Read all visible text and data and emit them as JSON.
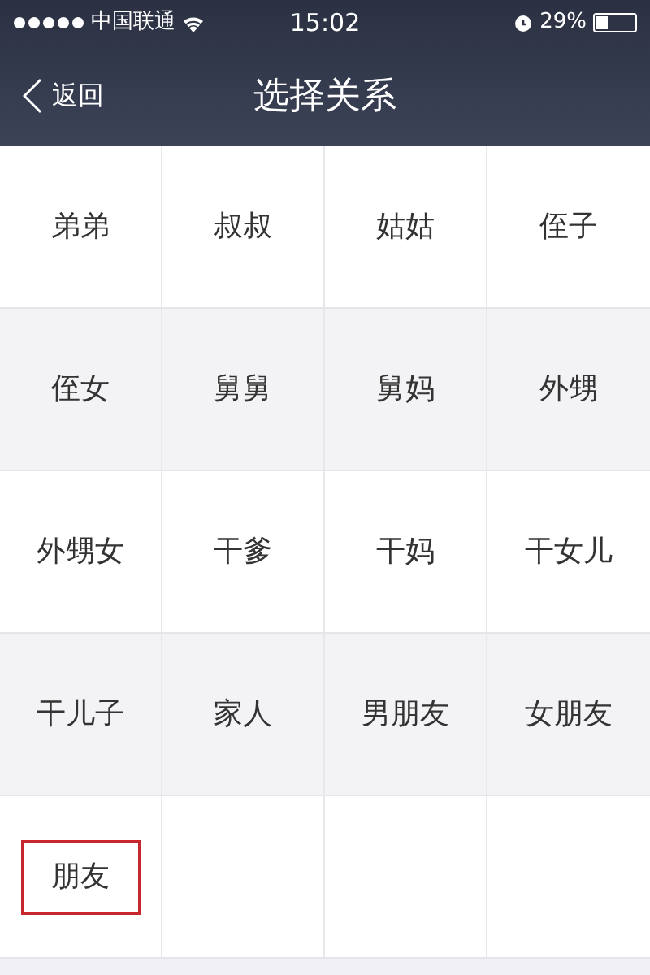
{
  "status_bar": {
    "carrier": "中国联通",
    "time": "15:02",
    "battery_percent": "29%",
    "battery": {
      "level": 0.29
    }
  },
  "nav": {
    "back": "返回",
    "title": "选择关系"
  },
  "relations": [
    {
      "label": "弟弟",
      "selected": false
    },
    {
      "label": "叔叔",
      "selected": false
    },
    {
      "label": "姑姑",
      "selected": false
    },
    {
      "label": "侄子",
      "selected": false
    },
    {
      "label": "侄女",
      "selected": false
    },
    {
      "label": "舅舅",
      "selected": false
    },
    {
      "label": "舅妈",
      "selected": false
    },
    {
      "label": "外甥",
      "selected": false
    },
    {
      "label": "外甥女",
      "selected": false
    },
    {
      "label": "干爹",
      "selected": false
    },
    {
      "label": "干妈",
      "selected": false
    },
    {
      "label": "干女儿",
      "selected": false
    },
    {
      "label": "干儿子",
      "selected": false
    },
    {
      "label": "家人",
      "selected": false
    },
    {
      "label": "男朋友",
      "selected": false
    },
    {
      "label": "女朋友",
      "selected": false
    },
    {
      "label": "朋友",
      "selected": true
    }
  ]
}
